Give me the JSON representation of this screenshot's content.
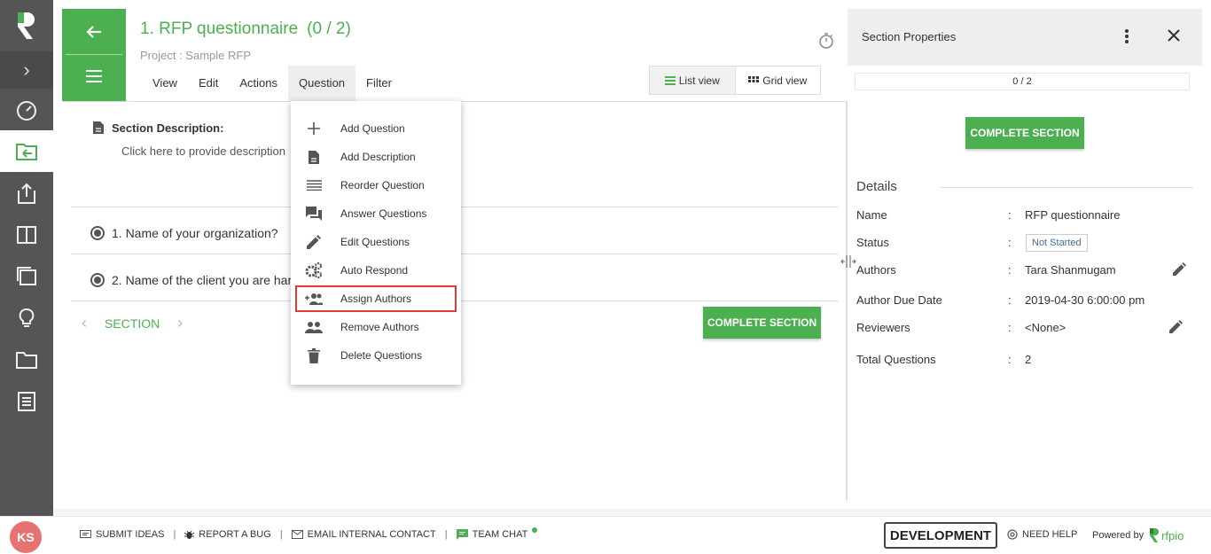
{
  "header": {
    "title": "1. RFP questionnaire",
    "count": "(0 / 2)",
    "project": "Project : Sample RFP"
  },
  "menubar": [
    "View",
    "Edit",
    "Actions",
    "Question",
    "Filter"
  ],
  "view_toggle": {
    "list": "List view",
    "grid": "Grid view"
  },
  "section_description": {
    "label": "Section Description:",
    "placeholder": "Click here to provide description"
  },
  "questions": [
    {
      "text": "1. Name of your organization?"
    },
    {
      "text": "2. Name of the client you are har"
    }
  ],
  "section_nav": {
    "label": "SECTION"
  },
  "complete_button": "COMPLETE SECTION",
  "dropdown": [
    {
      "label": "Add Question",
      "icon": "plus-icon"
    },
    {
      "label": "Add Description",
      "icon": "description-icon"
    },
    {
      "label": "Reorder Question",
      "icon": "reorder-icon"
    },
    {
      "label": "Answer Questions",
      "icon": "forum-icon"
    },
    {
      "label": "Edit Questions",
      "icon": "pencil-icon"
    },
    {
      "label": "Auto Respond",
      "icon": "gears-icon"
    },
    {
      "label": "Assign Authors",
      "icon": "add-people-icon"
    },
    {
      "label": "Remove Authors",
      "icon": "people-icon"
    },
    {
      "label": "Delete Questions",
      "icon": "trash-icon"
    }
  ],
  "right_panel": {
    "title": "Section Properties",
    "progress": "0 / 2",
    "complete_button": "COMPLETE SECTION",
    "details_heading": "Details",
    "details": {
      "name_label": "Name",
      "name": "RFP questionnaire",
      "status_label": "Status",
      "status": "Not Started",
      "authors_label": "Authors",
      "authors": "Tara Shanmugam",
      "due_label": "Author Due Date",
      "due": "2019-04-30 6:00:00 pm",
      "reviewers_label": "Reviewers",
      "reviewers": "<None>",
      "total_label": "Total Questions",
      "total": "2",
      "colon": ":"
    }
  },
  "footer": {
    "avatar": "KS",
    "submit_ideas": "SUBMIT IDEAS",
    "report_bug": "REPORT A BUG",
    "email_contact": "EMAIL INTERNAL CONTACT",
    "team_chat": "TEAM CHAT",
    "separator": "|",
    "environment": "DEVELOPMENT",
    "need_help": "NEED HELP",
    "powered_by": "Powered by",
    "brand": "rfpio"
  },
  "colors": {
    "accent": "#4caf50",
    "sidebar": "#555555",
    "highlight": "#e53935"
  }
}
